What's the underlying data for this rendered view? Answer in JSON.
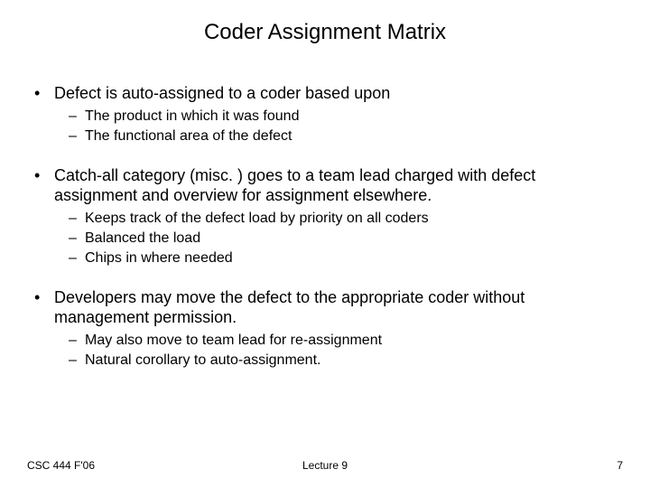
{
  "title": "Coder Assignment Matrix",
  "bullets": [
    {
      "text": "Defect is auto-assigned to a coder based upon",
      "sub": [
        "The product in which it was found",
        "The functional area of the defect"
      ]
    },
    {
      "text": "Catch-all category (misc. ) goes to a team lead charged with defect assignment and overview for assignment elsewhere.",
      "sub": [
        "Keeps track of the defect load by priority on all coders",
        "Balanced the load",
        "Chips in where needed"
      ]
    },
    {
      "text": "Developers may move the defect to the appropriate coder without management permission.",
      "sub": [
        "May also move to team lead for re-assignment",
        "Natural corollary to auto-assignment."
      ]
    }
  ],
  "footer": {
    "left": "CSC 444 F'06",
    "center": "Lecture 9",
    "right": "7"
  }
}
